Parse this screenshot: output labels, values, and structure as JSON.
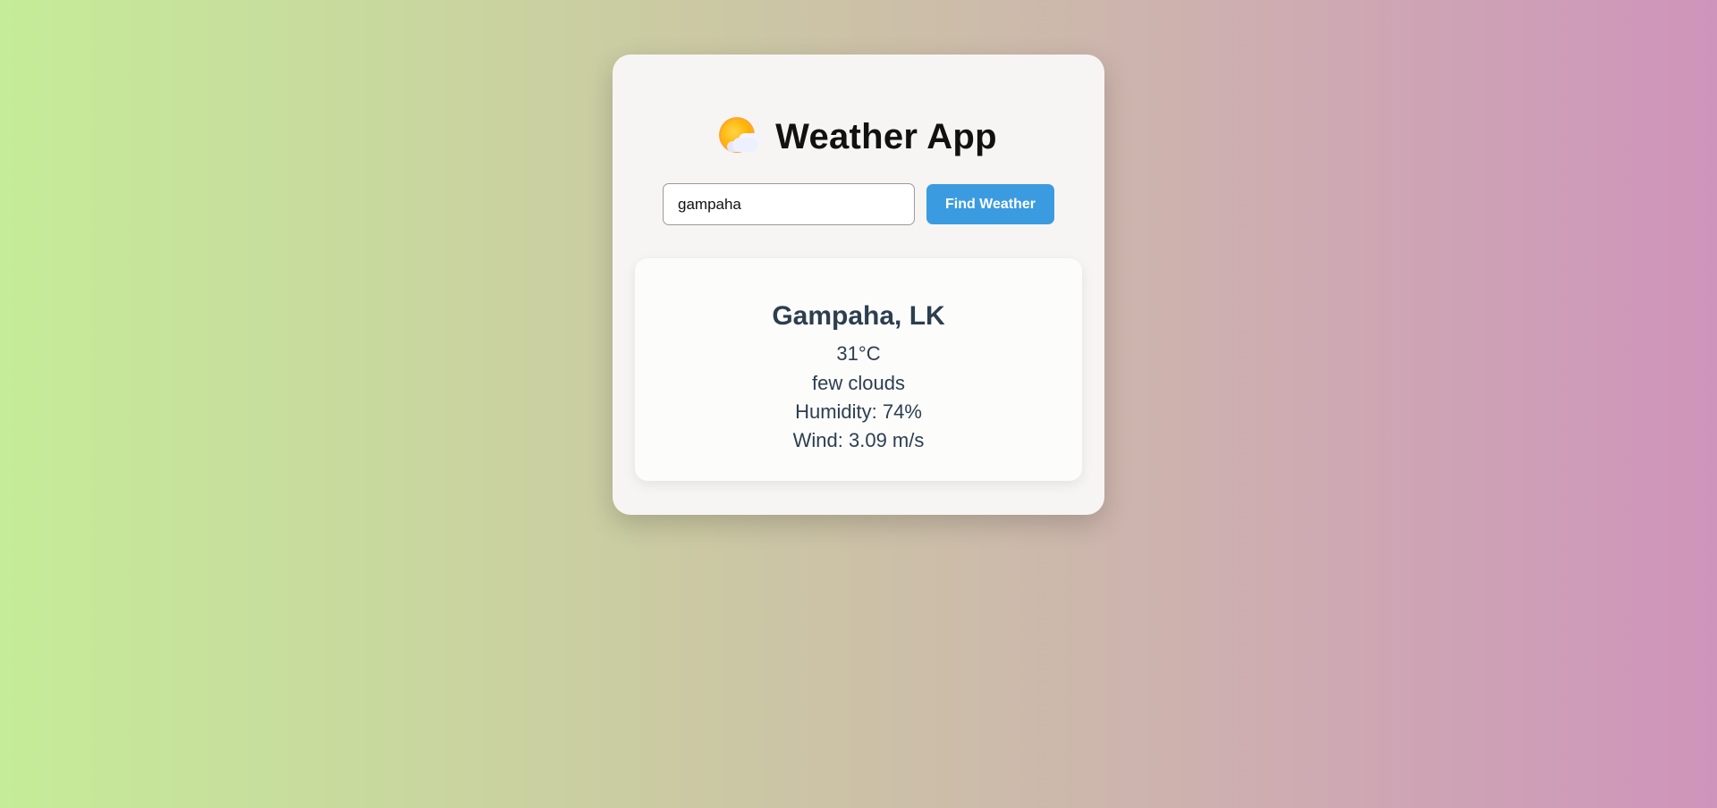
{
  "app": {
    "title": "Weather App",
    "icon": "sun-behind-cloud-icon"
  },
  "search": {
    "value": "gampaha",
    "button_label": "Find Weather"
  },
  "result": {
    "city": "Gampaha, LK",
    "temperature": "31°C",
    "description": "few clouds",
    "humidity": "Humidity: 74%",
    "wind": "Wind: 3.09 m/s"
  },
  "colors": {
    "button": "#3b9be0",
    "text": "#2c3e50",
    "background_left": "#c5ec98",
    "background_right": "#cf94bb"
  }
}
